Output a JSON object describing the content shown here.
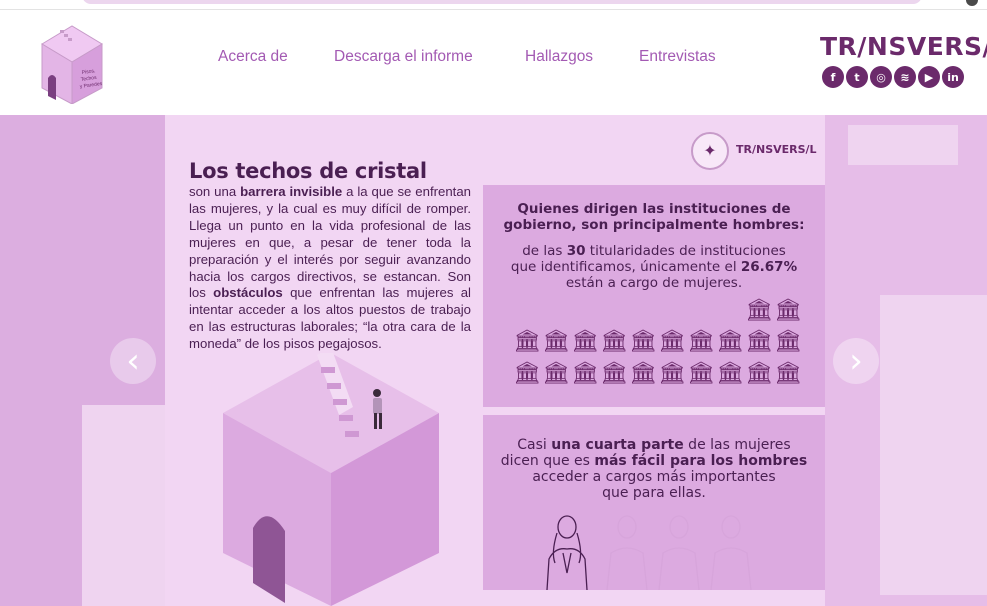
{
  "nav": {
    "items": [
      "Acerca de",
      "Descarga el informe",
      "Hallazgos",
      "Entrevistas"
    ]
  },
  "logo": {
    "text": "Pisos, Techos y Paredes"
  },
  "brand": {
    "name": "TR/NSVERS/L",
    "socials": [
      {
        "icon": "facebook-icon",
        "glyph": "f"
      },
      {
        "icon": "twitter-icon",
        "glyph": "t"
      },
      {
        "icon": "instagram-icon",
        "glyph": "◎"
      },
      {
        "icon": "spotify-icon",
        "glyph": "≋"
      },
      {
        "icon": "youtube-icon",
        "glyph": "▶"
      },
      {
        "icon": "linkedin-icon",
        "glyph": "in"
      }
    ]
  },
  "slide": {
    "title": "Los techos de cristal",
    "paragraph_parts": [
      {
        "t": "son una ",
        "b": false
      },
      {
        "t": "barrera invisible",
        "b": true
      },
      {
        "t": " a la que se enfrentan las mujeres, y la cual es muy difícil de romper. Llega un punto en la vida profesional de las mujeres en que, a pesar de tener toda la preparación y el interés por seguir avanzando hacia los cargos directivos, se estancan. Son los ",
        "b": false
      },
      {
        "t": "obstáculos",
        "b": true
      },
      {
        "t": " que enfrentan las mujeres al intentar acceder a los altos puestos de trabajo en las estructuras laborales; “la otra cara de la moneda” de los pisos pegajosos.",
        "b": false
      }
    ],
    "mini_brand": "TR/NSVERS/L",
    "card1": {
      "heading_line1": "Quienes dirigen las instituciones de",
      "heading_line2": "gobierno, son principalmente hombres:",
      "line1_pre": "de las ",
      "line1_bold": "30",
      "line1_post": " titularidades de instituciones",
      "line2_pre": "que identificamos, únicamente el ",
      "line2_bold": "26.67%",
      "line3": "están a cargo de mujeres.",
      "building_icon": "🏛"
    },
    "card2": {
      "line1_pre": "Casi ",
      "line1_bold": "una cuarta parte",
      "line1_post": " de las mujeres",
      "line2_pre": "dicen que es ",
      "line2_bold": "más fácil para los hombres",
      "line3": "acceder a cargos más importantes",
      "line4": "que para ellas."
    }
  },
  "carousel": {
    "prev_glyph": "‹",
    "next_glyph": "›"
  },
  "colors": {
    "accent": "#a35ab3",
    "dark": "#4a1f52",
    "brand": "#6b2a6b",
    "card": "#dcaae0",
    "slide_bg": "#f2d6f3"
  }
}
